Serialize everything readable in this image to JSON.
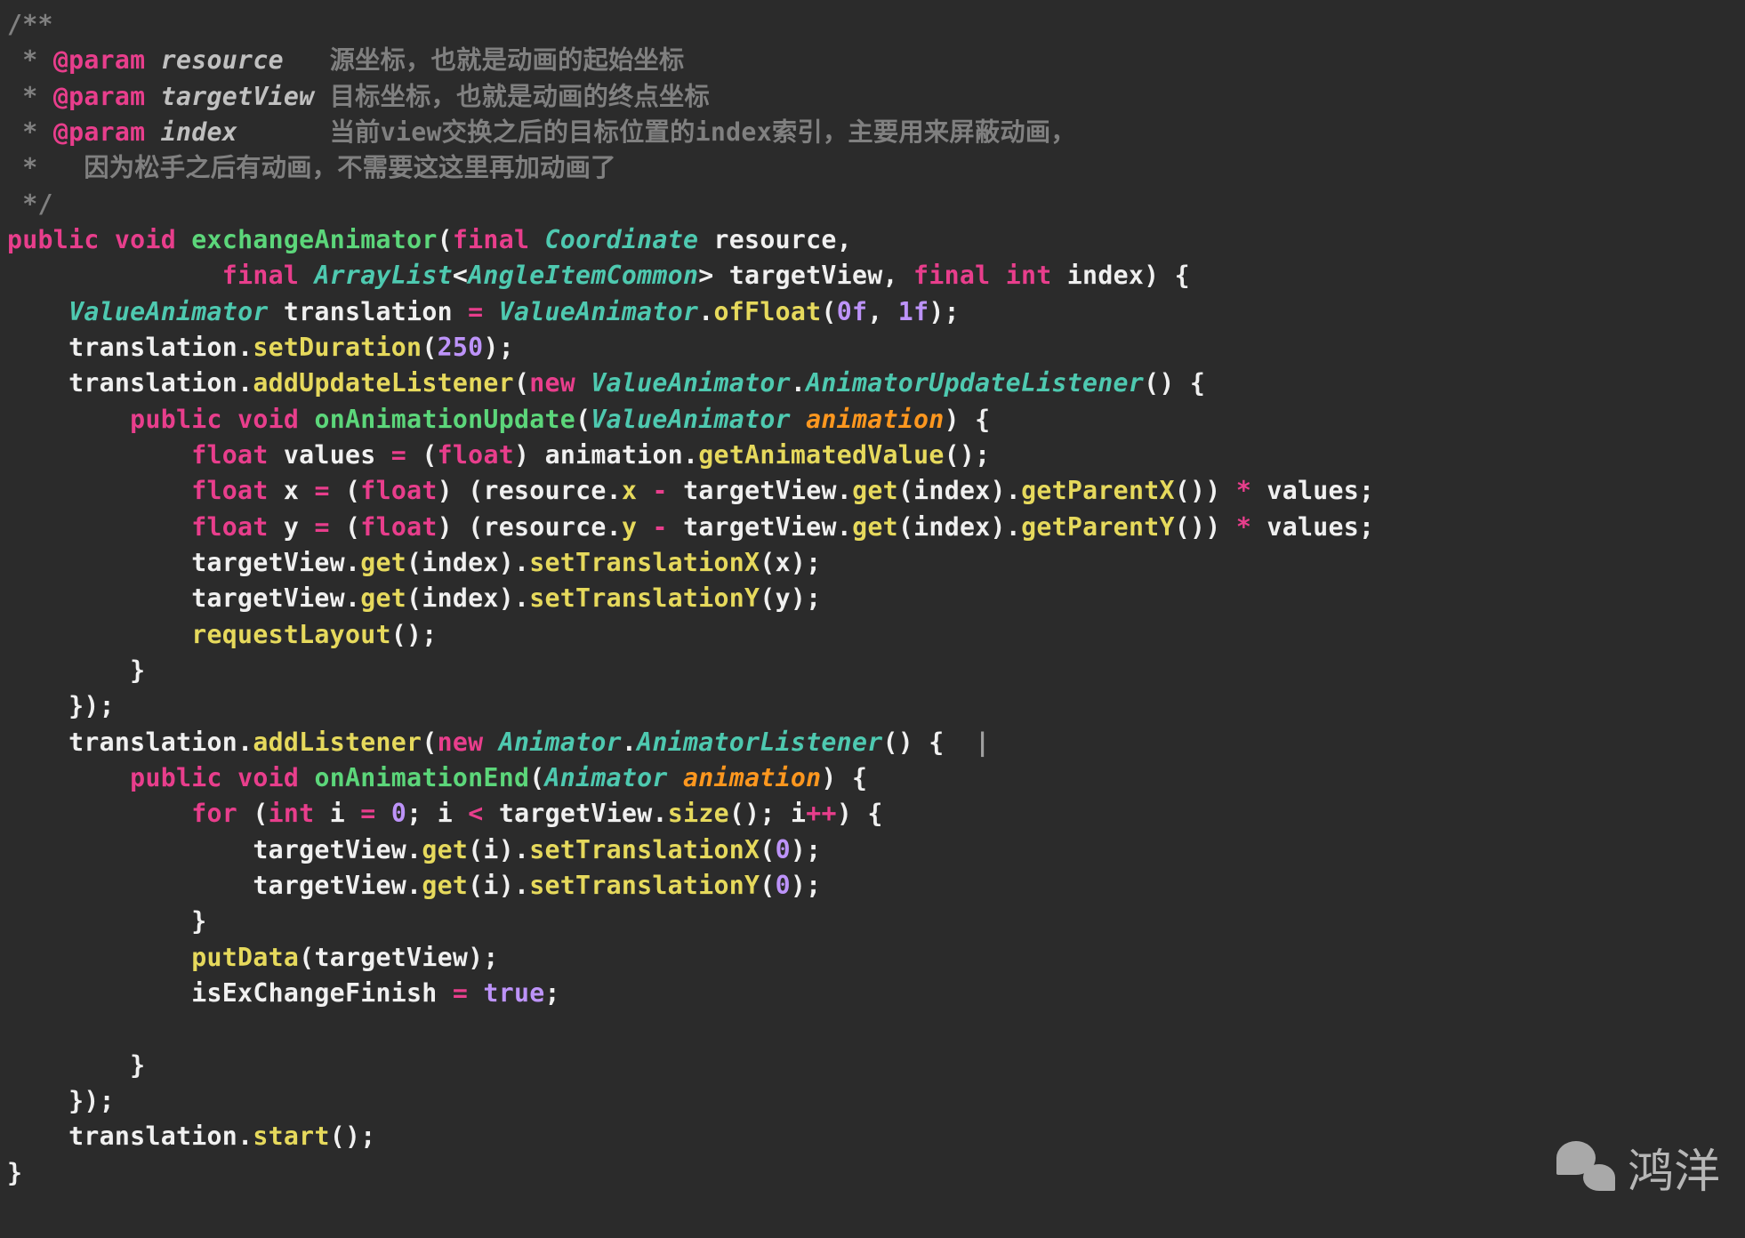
{
  "doc": {
    "open": "/**",
    "l1a": " * ",
    "p_tag": "@param",
    "p1_name": " resource   ",
    "p1_desc": "源坐标，也就是动画的起始坐标",
    "l2a": " * ",
    "p2_name": " targetView ",
    "p2_desc": "目标坐标，也就是动画的终点坐标",
    "l3a": " * ",
    "p3_name": " index      ",
    "p3_desc": "当前view交换之后的目标位置的index索引，主要用来屏蔽动画，",
    "l4": " *   因为松手之后有动画，不需要这这里再加动画了",
    "close": " */"
  },
  "kw": {
    "public": "public",
    "void": "void",
    "final": "final",
    "new": "new",
    "for": "for",
    "int": "int",
    "float": "float",
    "true": "true"
  },
  "types": {
    "Coordinate": "Coordinate",
    "ArrayList": "ArrayList",
    "AngleItemCommon": "AngleItemCommon",
    "ValueAnimator": "ValueAnimator",
    "Animator": "Animator",
    "AnimatorUpdateListener": "AnimatorUpdateListener",
    "AnimatorListener": "AnimatorListener"
  },
  "ids": {
    "exchangeAnimator": "exchangeAnimator",
    "resource": "resource",
    "targetView": "targetView",
    "index": "index",
    "translation": "translation",
    "animation": "animation",
    "values": "values",
    "x": "x",
    "y": "y",
    "i": "i",
    "isExChangeFinish": "isExChangeFinish"
  },
  "mth": {
    "ofFloat": "ofFloat",
    "setDuration": "setDuration",
    "addUpdateListener": "addUpdateListener",
    "onAnimationUpdate": "onAnimationUpdate",
    "getAnimatedValue": "getAnimatedValue",
    "get": "get",
    "getParentX": "getParentX",
    "getParentY": "getParentY",
    "setTranslationX": "setTranslationX",
    "setTranslationY": "setTranslationY",
    "requestLayout": "requestLayout",
    "addListener": "addListener",
    "onAnimationEnd": "onAnimationEnd",
    "size": "size",
    "putData": "putData",
    "start": "start"
  },
  "num": {
    "zeroF": "0f",
    "oneF": "1f",
    "d250": "250",
    "zero": "0"
  },
  "watermark": "鸿洋"
}
